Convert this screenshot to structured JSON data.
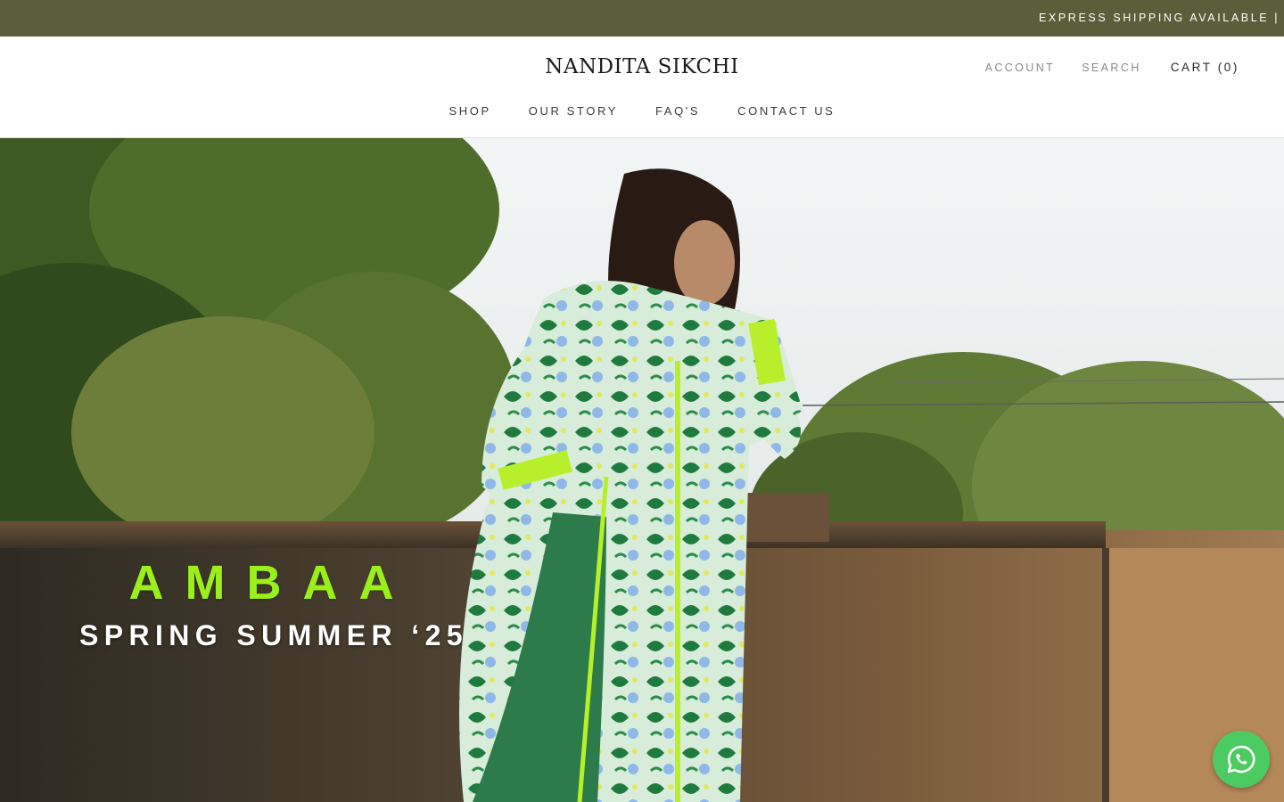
{
  "announcement": {
    "text": "EXPRESS SHIPPING AVAILABLE | W"
  },
  "header": {
    "logo": "NANDITA SIKCHI",
    "account_label": "ACCOUNT",
    "search_label": "SEARCH",
    "cart_label": "CART (0)"
  },
  "nav": {
    "items": [
      {
        "label": "SHOP"
      },
      {
        "label": "OUR STORY"
      },
      {
        "label": "FAQ'S"
      },
      {
        "label": "CONTACT US"
      }
    ]
  },
  "hero": {
    "title": "AMBAA",
    "subtitle": "SPRING SUMMER ‘25"
  },
  "colors": {
    "announcement_bg": "#5c5d3a",
    "hero_title": "#9bf01c",
    "whatsapp": "#4ccb62"
  },
  "icons": {
    "whatsapp": "whatsapp-icon"
  }
}
